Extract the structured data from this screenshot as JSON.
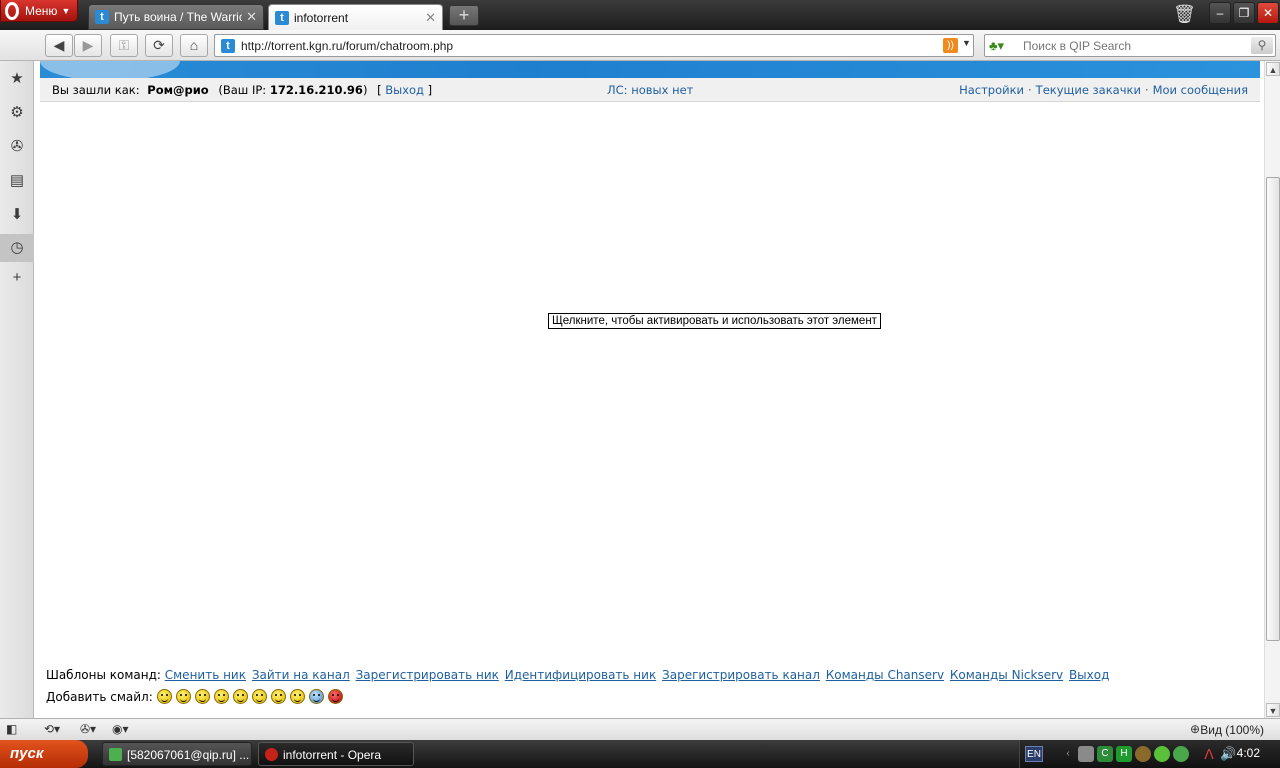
{
  "browser": {
    "menu_label": "Меню",
    "tabs": [
      {
        "label": "Путь воина / The Warrio...",
        "favicon": "t",
        "active": false
      },
      {
        "label": "infotorrent",
        "favicon": "t",
        "active": true
      }
    ],
    "new_tab_symbol": "+",
    "close_symbol": "✕",
    "window_buttons": {
      "minimize": "–",
      "restore": "❐",
      "close": "✕"
    }
  },
  "toolbar": {
    "url": "http://torrent.kgn.ru/forum/chatroom.php",
    "search_placeholder": "Поиск в QIP Search",
    "buttons": [
      "back",
      "forward",
      "wand",
      "reload",
      "home"
    ]
  },
  "page": {
    "userbar": {
      "logged_in_label": "Вы зашли как:",
      "username": "Ром@рио",
      "ip_prefix": "(Ваш IP:",
      "ip": "172.16.210.96",
      "ip_suffix": ")",
      "logout_open": "[",
      "logout_label": "Выход",
      "logout_close": "]",
      "pm_status": "ЛС: новых нет",
      "settings": "Настройки",
      "current_downloads": "Текущие закачки",
      "my_messages": "Мои сообщения",
      "separator": "·"
    },
    "flash_tooltip": "Щелкните, чтобы активировать и использовать этот элемент",
    "commands": {
      "label": "Шаблоны команд:",
      "items": [
        "Сменить ник",
        "Зайти на канал",
        "Зарегистрировать ник",
        "Идентифицировать ник",
        "Зарегистрировать канал",
        "Команды Chanserv",
        "Команды Nickserv",
        "Выход"
      ]
    },
    "smiles": {
      "label": "Добавить смайл:",
      "count": 10
    }
  },
  "statusbar": {
    "zoom_label": "Вид (100%)"
  },
  "taskbar": {
    "start_label": "пуск",
    "tasks": [
      {
        "label": "[582067061@qip.ru] ..."
      },
      {
        "label": "infotorrent - Opera"
      }
    ],
    "language": "EN",
    "clock": "4:02"
  },
  "colors": {
    "banner_blue": "#2a8cd6",
    "link_blue": "#1f5f9f",
    "opera_red": "#c5221a",
    "start_orange": "#d8481a"
  }
}
